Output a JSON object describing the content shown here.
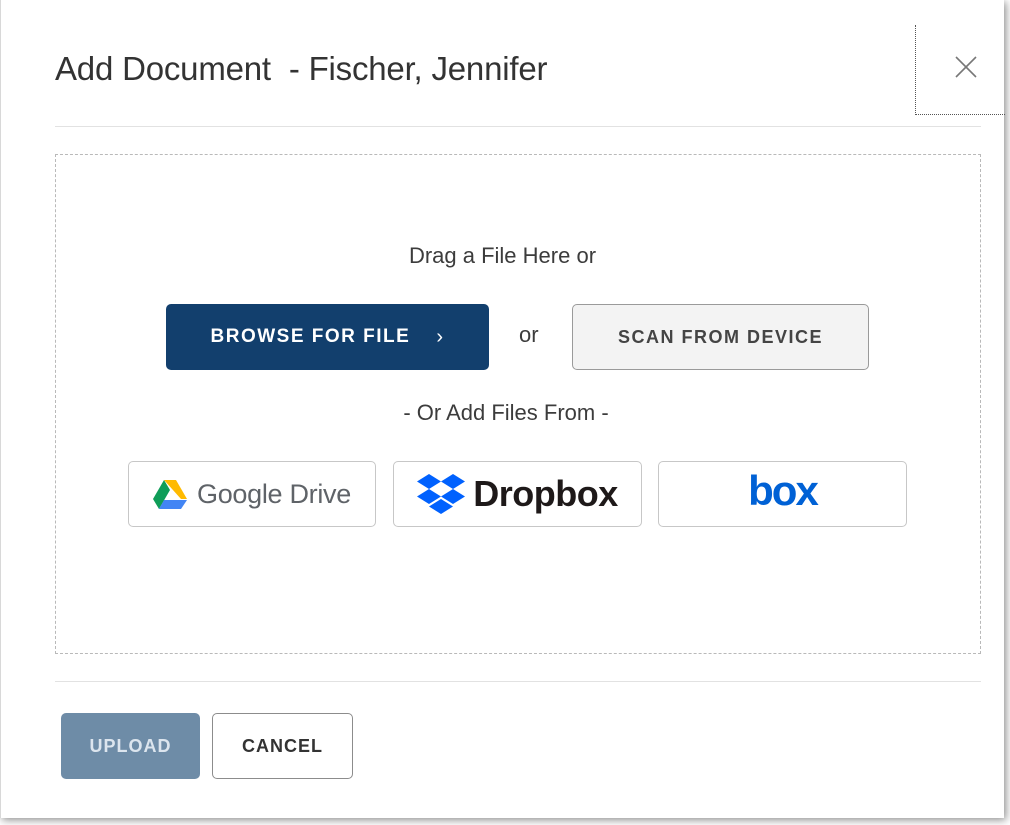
{
  "dialog": {
    "title": "Add Document  - Fischer, Jennifer",
    "close_icon": "close-icon"
  },
  "dropzone": {
    "drag_text": "Drag a File Here or",
    "browse_label": "BROWSE FOR FILE",
    "browse_chevron": "›",
    "or_text": "or",
    "scan_label": "SCAN FROM DEVICE",
    "add_from_text": "- Or Add Files From -"
  },
  "sources": {
    "google_drive": "Google Drive",
    "dropbox": "Dropbox",
    "box": "box"
  },
  "footer": {
    "upload_label": "UPLOAD",
    "upload_disabled": true,
    "cancel_label": "CANCEL"
  },
  "colors": {
    "primary": "#123f6d",
    "disabled": "#6e8ca7",
    "box_brand": "#0061d5",
    "dropbox_brand": "#0061fe"
  }
}
